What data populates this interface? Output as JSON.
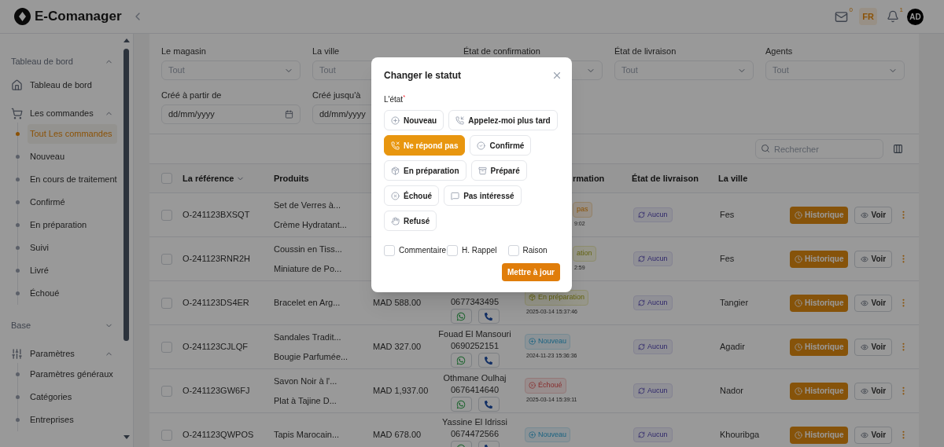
{
  "topbar": {
    "app_name": "E-Comanager",
    "mail_count": "0",
    "language": "FR",
    "notification_count": "1",
    "avatar": "AD"
  },
  "sidebar": {
    "groups": [
      {
        "kind": "heading",
        "label": "Tableau de bord",
        "expanded": true,
        "children": [
          {
            "label": "Tableau de bord",
            "selected": false
          }
        ]
      },
      {
        "kind": "menu",
        "label": "Les commandes",
        "expanded": true,
        "children": [
          {
            "label": "Tout Les commandes",
            "selected": true
          },
          {
            "label": "Nouveau",
            "selected": false
          },
          {
            "label": "En cours de traitement",
            "selected": false
          },
          {
            "label": "Confirmé",
            "selected": false
          },
          {
            "label": "En préparation",
            "selected": false
          },
          {
            "label": "Suivi",
            "selected": false
          },
          {
            "label": "Livré",
            "selected": false
          },
          {
            "label": "Échoué",
            "selected": false
          }
        ]
      },
      {
        "kind": "heading",
        "label": "Base",
        "expanded": false
      },
      {
        "kind": "menu",
        "label": "Paramètres",
        "expanded": true,
        "children": [
          {
            "label": "Paramètres généraux",
            "selected": false
          },
          {
            "label": "Catégories",
            "selected": false
          },
          {
            "label": "Entreprises",
            "selected": false
          }
        ]
      }
    ]
  },
  "filters": [
    {
      "kind": "select",
      "label": "Le magasin",
      "value": "Tout"
    },
    {
      "kind": "select",
      "label": "La ville",
      "value": "Tout"
    },
    {
      "kind": "select",
      "label": "État de confirmation"
    },
    {
      "kind": "select",
      "label": "État de livraison",
      "value": "Tout"
    },
    {
      "kind": "select",
      "label": "Agents",
      "value": "Tout"
    },
    {
      "kind": "date",
      "label": "Créé à partir de",
      "placeholder": "dd/mm/yyyy"
    },
    {
      "kind": "date",
      "label": "Créé jusqu'à",
      "placeholder": "dd/mm/yyyy"
    }
  ],
  "search": {
    "placeholder": "Rechercher"
  },
  "table": {
    "all_checked": false,
    "columns": [
      {
        "label": "La référence",
        "sortable": true
      },
      {
        "label": "Produits",
        "sortable": false
      },
      {
        "label": "rmation",
        "sortable": false,
        "partial": true
      },
      {
        "label": "État de livraison",
        "sortable": false
      },
      {
        "label": "La ville",
        "sortable": false
      }
    ],
    "rows": [
      {
        "checked": false,
        "ref": "O-241123BXSQT",
        "products": [
          "Set de Verres à...",
          "Crème Hydratant..."
        ],
        "confirmation": {
          "kind": "no_answer",
          "text": "pas",
          "date": "9:02",
          "partial": true
        },
        "delivery": "Aucun",
        "city": "Fes",
        "history": "Historique",
        "view": "Voir"
      },
      {
        "checked": false,
        "ref": "O-241123RNR2H",
        "products": [
          "Coussin en Tiss...",
          "Miniature de Po..."
        ],
        "confirmation": {
          "kind": "preparing",
          "text": "ation",
          "date": "2:59",
          "partial": true
        },
        "delivery": "Aucun",
        "city": "Fes",
        "history": "Historique",
        "view": "Voir"
      },
      {
        "checked": false,
        "ref": "O-241123DS4ER",
        "products": [
          "Bracelet en Arg..."
        ],
        "price": "MAD 588.00",
        "client": {
          "phone": "0677343495"
        },
        "confirmation": {
          "kind": "preparing",
          "text": "En préparation",
          "date": "2025-03-14 15:37:46",
          "partial": false
        },
        "delivery": "Aucun",
        "city": "Tangier",
        "history": "Historique",
        "view": "Voir"
      },
      {
        "checked": false,
        "ref": "O-241123CJLQF",
        "products": [
          "Sandales Tradit...",
          "Bougie Parfumée..."
        ],
        "price": "MAD 327.00",
        "client": {
          "name": "Fouad El Mansouri",
          "phone": "0690252151"
        },
        "confirmation": {
          "kind": "new",
          "text": "Nouveau",
          "date": "2024-11-23 15:36:36",
          "partial": false
        },
        "delivery": "Aucun",
        "city": "Agadir",
        "history": "Historique",
        "view": "Voir"
      },
      {
        "checked": false,
        "ref": "O-241123GW6FJ",
        "products": [
          "Savon Noir à l'...",
          "Plat à Tajine D..."
        ],
        "price": "MAD 1,937.00",
        "client": {
          "name": "Othmane Oulhaj",
          "phone": "0676414640"
        },
        "confirmation": {
          "kind": "failed",
          "text": "Échoué",
          "date": "2025-03-14 15:39:11",
          "partial": false
        },
        "delivery": "Aucun",
        "city": "Nador",
        "history": "Historique",
        "view": "Voir"
      },
      {
        "checked": false,
        "ref": "O-241123QWPOS",
        "products": [
          "Tapis Marocain..."
        ],
        "price": "MAD 678.00",
        "client": {
          "name": "Yassine El Idrissi",
          "phone": "0674472566"
        },
        "confirmation": {
          "kind": "new",
          "text": "Nouveau",
          "partial": false
        },
        "delivery": "Aucun",
        "city": "Khouribga",
        "history": "Historique",
        "view": "Voir"
      }
    ]
  },
  "dialog": {
    "title": "Changer le statut",
    "field_label": "L'état$^{*}$",
    "options": [
      {
        "kind": "new",
        "label": "Nouveau",
        "selected": false
      },
      {
        "kind": "callback",
        "label": "Appelez-moi plus tard",
        "selected": false
      },
      {
        "kind": "no_answer",
        "label": "Ne répond pas",
        "selected": true
      },
      {
        "kind": "confirmed",
        "label": "Confirmé",
        "selected": false
      },
      {
        "kind": "preparing",
        "label": "En préparation",
        "selected": false
      },
      {
        "kind": "prepared",
        "label": "Préparé",
        "selected": false
      },
      {
        "kind": "failed",
        "label": "Échoué",
        "selected": false
      },
      {
        "kind": "not_interested",
        "label": "Pas intéressé",
        "selected": false
      },
      {
        "kind": "refused",
        "label": "Refusé",
        "selected": false
      }
    ],
    "checkboxes": [
      {
        "label": "Commentaire",
        "checked": false
      },
      {
        "label": "H. Rappel",
        "checked": false
      },
      {
        "label": "Raison",
        "checked": false
      }
    ],
    "submit": "Mettre à jour"
  }
}
